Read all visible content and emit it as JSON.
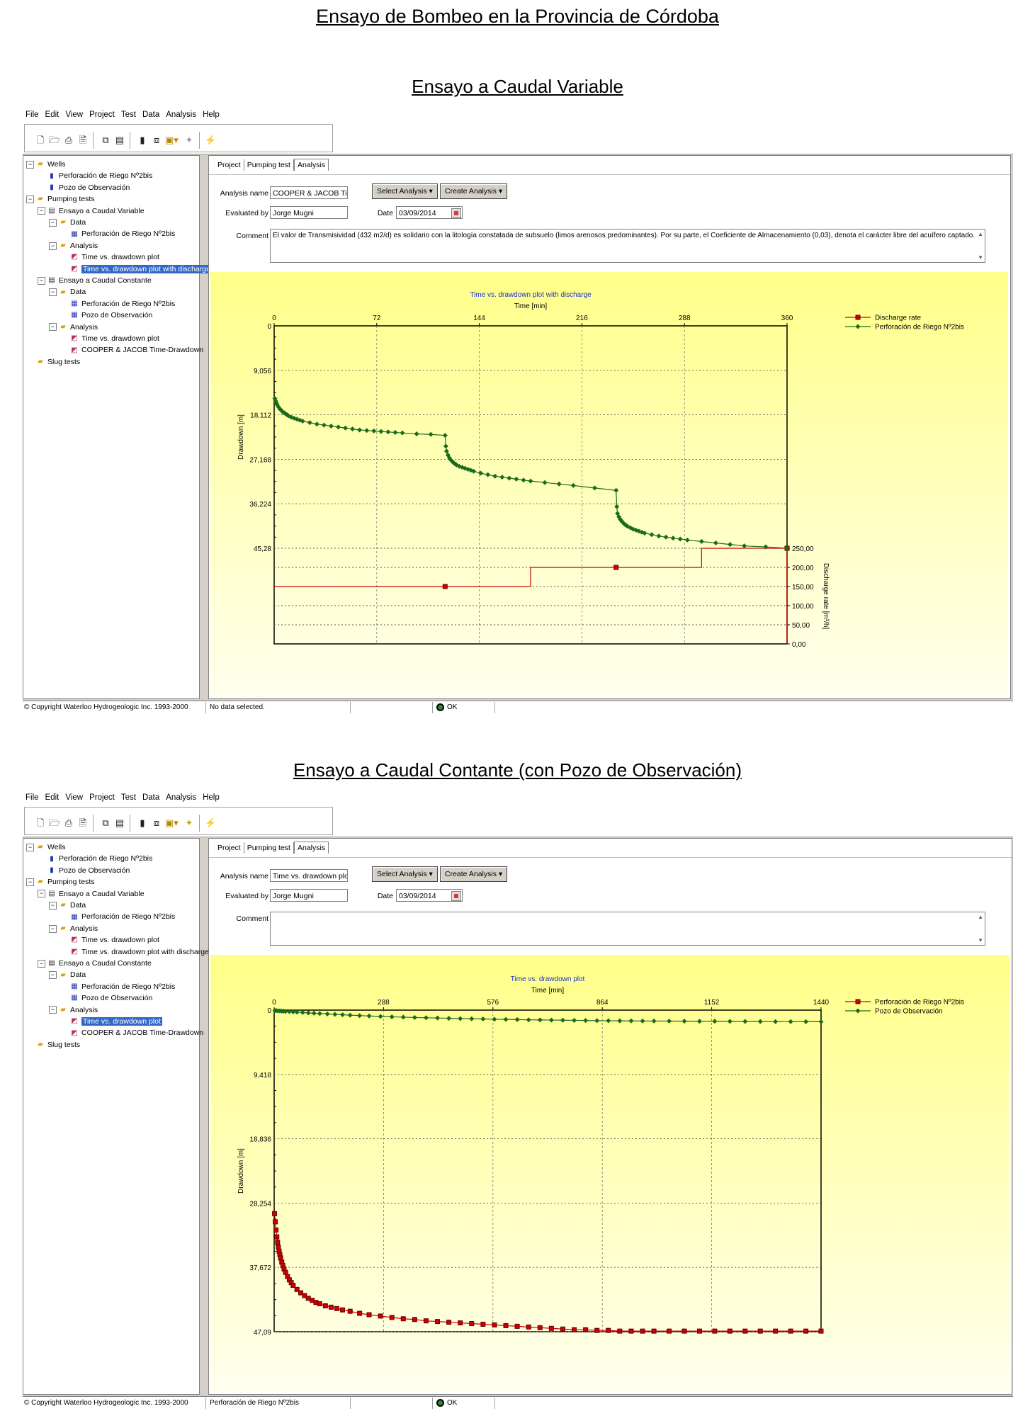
{
  "doc_title": "Ensayo de Bombeo en la Provincia de Córdoba",
  "menu": [
    "File",
    "Edit",
    "View",
    "Project",
    "Test",
    "Data",
    "Analysis",
    "Help"
  ],
  "toolbar_icons": [
    "new-file-icon",
    "open-folder-icon",
    "print-icon",
    "print-preview-icon",
    "copy-icon",
    "paste-icon",
    "clipboard-icon",
    "export-icon",
    "template-dropdown-icon",
    "lightbulb-icon",
    "wand-icon"
  ],
  "tabs": [
    "Project",
    "Pumping test",
    "Analysis"
  ],
  "form_labels": {
    "analysis_name": "Analysis name",
    "evaluated_by": "Evaluated by",
    "date": "Date",
    "comment": "Comment",
    "select_analysis": "Select Analysis",
    "create_analysis": "Create Analysis"
  },
  "panels": [
    {
      "section_title": "Ensayo a Caudal Variable",
      "tree": [
        {
          "label": "Wells",
          "level": 0,
          "icon": "folder",
          "expander": "-"
        },
        {
          "label": "Perforación de Riego Nº2bis",
          "level": 1,
          "icon": "well"
        },
        {
          "label": "Pozo de Observación",
          "level": 1,
          "icon": "well"
        },
        {
          "label": "Pumping tests",
          "level": 0,
          "icon": "folder",
          "expander": "-"
        },
        {
          "label": "Ensayo a Caudal Variable",
          "level": 1,
          "icon": "doc",
          "expander": "-"
        },
        {
          "label": "Data",
          "level": 2,
          "icon": "folder",
          "expander": "-"
        },
        {
          "label": "Perforación de Riego Nº2bis",
          "level": 3,
          "icon": "grid"
        },
        {
          "label": "Analysis",
          "level": 2,
          "icon": "folder",
          "expander": "-"
        },
        {
          "label": "Time vs. drawdown plot",
          "level": 3,
          "icon": "plot"
        },
        {
          "label": "Time vs. drawdown plot with discharge",
          "level": 3,
          "icon": "plot",
          "selected": true
        },
        {
          "label": "Ensayo a Caudal Constante",
          "level": 1,
          "icon": "doc",
          "expander": "-"
        },
        {
          "label": "Data",
          "level": 2,
          "icon": "folder",
          "expander": "-"
        },
        {
          "label": "Perforación de Riego Nº2bis",
          "level": 3,
          "icon": "grid"
        },
        {
          "label": "Pozo de Observación",
          "level": 3,
          "icon": "grid"
        },
        {
          "label": "Analysis",
          "level": 2,
          "icon": "folder",
          "expander": "-"
        },
        {
          "label": "Time vs. drawdown plot",
          "level": 3,
          "icon": "plot"
        },
        {
          "label": "COOPER & JACOB Time-Drawdown",
          "level": 3,
          "icon": "plot"
        },
        {
          "label": "Slug tests",
          "level": 0,
          "icon": "folder"
        }
      ],
      "analysis_name": "COOPER & JACOB Time-D",
      "evaluated_by": "Jorge Mugni",
      "date": "03/09/2014",
      "comment": "El valor de Transmisividad (432 m2/d) es solidario con la litología constatada de subsuelo (limos arenosos predominantes). Por su parte, el Coeficiente de Almacenamiento (0,03), denota el carácter libre del acuífero captado.",
      "status": {
        "copyright": "© Copyright Waterloo Hydrogeologic Inc. 1993-2000",
        "message": "No data selected.",
        "ok": "OK"
      }
    },
    {
      "section_title": "Ensayo a Caudal Contante (con Pozo de Observación)",
      "tree": [
        {
          "label": "Wells",
          "level": 0,
          "icon": "folder",
          "expander": "-"
        },
        {
          "label": "Perforación de Riego Nº2bis",
          "level": 1,
          "icon": "well"
        },
        {
          "label": "Pozo de Observación",
          "level": 1,
          "icon": "well"
        },
        {
          "label": "Pumping tests",
          "level": 0,
          "icon": "folder",
          "expander": "-"
        },
        {
          "label": "Ensayo a Caudal Variable",
          "level": 1,
          "icon": "doc",
          "expander": "-"
        },
        {
          "label": "Data",
          "level": 2,
          "icon": "folder",
          "expander": "-"
        },
        {
          "label": "Perforación de Riego Nº2bis",
          "level": 3,
          "icon": "grid"
        },
        {
          "label": "Analysis",
          "level": 2,
          "icon": "folder",
          "expander": "-"
        },
        {
          "label": "Time vs. drawdown plot",
          "level": 3,
          "icon": "plot"
        },
        {
          "label": "Time vs. drawdown plot with discharge",
          "level": 3,
          "icon": "plot"
        },
        {
          "label": "Ensayo a Caudal Constante",
          "level": 1,
          "icon": "doc",
          "expander": "-"
        },
        {
          "label": "Data",
          "level": 2,
          "icon": "folder",
          "expander": "-"
        },
        {
          "label": "Perforación de Riego Nº2bis",
          "level": 3,
          "icon": "grid"
        },
        {
          "label": "Pozo de Observación",
          "level": 3,
          "icon": "grid"
        },
        {
          "label": "Analysis",
          "level": 2,
          "icon": "folder",
          "expander": "-"
        },
        {
          "label": "Time vs. drawdown plot",
          "level": 3,
          "icon": "plot",
          "selected": true
        },
        {
          "label": "COOPER & JACOB Time-Drawdown",
          "level": 3,
          "icon": "plot"
        },
        {
          "label": "Slug tests",
          "level": 0,
          "icon": "folder"
        }
      ],
      "analysis_name": "Time vs. drawdown plot",
      "evaluated_by": "Jorge Mugni",
      "date": "03/09/2014",
      "comment": "",
      "status": {
        "copyright": "© Copyright Waterloo Hydrogeologic Inc. 1993-2000",
        "message": "Perforación de Riego Nº2bis",
        "ok": "OK"
      }
    }
  ],
  "chart_data": [
    {
      "type": "line",
      "title": "Time vs. drawdown plot with discharge",
      "xlabel": "Time [min]",
      "ylabel": "Drawdown [m]",
      "y2label": "Discharge rate [m³/h]",
      "xlim": [
        0,
        360
      ],
      "ylim": [
        0,
        45.28
      ],
      "y_inverted": true,
      "x_ticks": [
        "0",
        "72",
        "144",
        "216",
        "288",
        "360"
      ],
      "y_ticks": [
        "0",
        "9,056",
        "18,112",
        "27,168",
        "36,224",
        "45,28"
      ],
      "y2lim": [
        0,
        250
      ],
      "y2_ticks": [
        "250,00",
        "200,00",
        "150,00",
        "100,00",
        "50,00",
        "0,00"
      ],
      "legend_position": "right",
      "series": [
        {
          "name": "Discharge rate",
          "color": "#cc0000",
          "marker": "square",
          "axis": "y2",
          "step": true,
          "x": [
            0,
            180,
            180,
            300,
            300,
            360
          ],
          "y": [
            150,
            150,
            200,
            200,
            250,
            250
          ],
          "markers_x": [
            120,
            240,
            360
          ],
          "markers_y": [
            150,
            200,
            250
          ]
        },
        {
          "name": "Perforación de Riego Nº2bis",
          "color": "#1a6b1a",
          "marker": "diamond",
          "axis": "y",
          "x": [
            0.5,
            1,
            1.5,
            2,
            3,
            4,
            5,
            6,
            7,
            8,
            9,
            10,
            12,
            14,
            16,
            18,
            20,
            25,
            30,
            35,
            40,
            45,
            50,
            55,
            60,
            65,
            70,
            75,
            80,
            85,
            90,
            100,
            110,
            120,
            120.5,
            121,
            122,
            123,
            124,
            125,
            126,
            127,
            128,
            130,
            132,
            134,
            136,
            138,
            140,
            145,
            150,
            155,
            160,
            165,
            170,
            175,
            180,
            190,
            200,
            210,
            225,
            240,
            240.5,
            241,
            242,
            243,
            244,
            245,
            246,
            247,
            248,
            250,
            252,
            254,
            256,
            258,
            260,
            265,
            270,
            275,
            280,
            285,
            290,
            300,
            310,
            320,
            330,
            345,
            360
          ],
          "y": [
            14.8,
            15.3,
            15.7,
            16.0,
            16.5,
            16.9,
            17.2,
            17.5,
            17.7,
            17.9,
            18.1,
            18.3,
            18.6,
            18.8,
            19.0,
            19.2,
            19.4,
            19.7,
            20.0,
            20.2,
            20.4,
            20.6,
            20.8,
            21.0,
            21.2,
            21.3,
            21.4,
            21.5,
            21.6,
            21.7,
            21.8,
            22.0,
            22.1,
            22.3,
            24.5,
            25.5,
            26.3,
            26.9,
            27.3,
            27.6,
            27.9,
            28.1,
            28.3,
            28.6,
            28.8,
            29.0,
            29.2,
            29.4,
            29.6,
            30.0,
            30.3,
            30.6,
            30.8,
            31.0,
            31.2,
            31.4,
            31.6,
            31.9,
            32.2,
            32.5,
            33.0,
            33.5,
            36.8,
            38.2,
            38.9,
            39.4,
            39.8,
            40.1,
            40.4,
            40.6,
            40.8,
            41.1,
            41.4,
            41.6,
            41.8,
            42.0,
            42.2,
            42.5,
            42.8,
            43.0,
            43.2,
            43.4,
            43.6,
            43.9,
            44.2,
            44.5,
            44.8,
            45.0,
            45.28
          ]
        }
      ]
    },
    {
      "type": "line",
      "title": "Time vs. drawdown plot",
      "xlabel": "Time [min]",
      "ylabel": "Drawdown [m]",
      "xlim": [
        0,
        1440
      ],
      "ylim": [
        0,
        47.09
      ],
      "y_inverted": true,
      "x_ticks": [
        "0",
        "288",
        "576",
        "864",
        "1152",
        "1440"
      ],
      "y_ticks": [
        "0",
        "9,418",
        "18,836",
        "28,254",
        "37,672",
        "47,09"
      ],
      "legend_position": "right",
      "series": [
        {
          "name": "Perforación de Riego Nº2bis",
          "color": "#cc0000",
          "marker": "square",
          "x": [
            1,
            3,
            5,
            7,
            9,
            11,
            13,
            15,
            17,
            20,
            23,
            26,
            30,
            35,
            40,
            45,
            50,
            60,
            70,
            80,
            90,
            100,
            110,
            120,
            135,
            150,
            165,
            180,
            200,
            225,
            250,
            280,
            310,
            340,
            370,
            400,
            430,
            460,
            490,
            520,
            550,
            580,
            610,
            640,
            670,
            700,
            730,
            760,
            790,
            820,
            850,
            880,
            910,
            940,
            970,
            1000,
            1040,
            1080,
            1120,
            1160,
            1200,
            1240,
            1280,
            1320,
            1360,
            1400,
            1440
          ],
          "y": [
            29.8,
            31.0,
            32.2,
            33.2,
            34.0,
            34.7,
            35.3,
            35.8,
            36.3,
            36.9,
            37.4,
            37.9,
            38.4,
            39.0,
            39.5,
            39.9,
            40.3,
            40.9,
            41.4,
            41.8,
            42.2,
            42.5,
            42.8,
            43.0,
            43.3,
            43.5,
            43.7,
            43.9,
            44.1,
            44.4,
            44.6,
            44.8,
            45.0,
            45.2,
            45.3,
            45.5,
            45.6,
            45.7,
            45.8,
            45.9,
            46.0,
            46.1,
            46.2,
            46.3,
            46.4,
            46.5,
            46.6,
            46.7,
            46.8,
            46.8,
            46.9,
            46.9,
            47.0,
            47.0,
            47.0,
            47.0,
            47.0,
            47.0,
            47.0,
            47.0,
            47.0,
            47.0,
            47.0,
            47.0,
            47.0,
            47.0,
            47.0
          ]
        },
        {
          "name": "Pozo de Observación",
          "color": "#1a6b1a",
          "marker": "diamond",
          "x": [
            2,
            6,
            10,
            15,
            20,
            25,
            30,
            40,
            50,
            60,
            75,
            90,
            105,
            120,
            140,
            160,
            180,
            200,
            225,
            250,
            280,
            310,
            340,
            370,
            400,
            430,
            460,
            490,
            520,
            550,
            580,
            610,
            640,
            670,
            700,
            730,
            760,
            790,
            820,
            850,
            880,
            910,
            940,
            970,
            1000,
            1040,
            1080,
            1120,
            1160,
            1200,
            1240,
            1280,
            1320,
            1360,
            1400,
            1440
          ],
          "y": [
            0.05,
            0.08,
            0.1,
            0.12,
            0.14,
            0.16,
            0.18,
            0.22,
            0.26,
            0.3,
            0.35,
            0.4,
            0.45,
            0.5,
            0.56,
            0.62,
            0.68,
            0.74,
            0.8,
            0.86,
            0.92,
            0.98,
            1.03,
            1.08,
            1.12,
            1.16,
            1.2,
            1.24,
            1.27,
            1.3,
            1.33,
            1.36,
            1.39,
            1.42,
            1.44,
            1.46,
            1.48,
            1.5,
            1.52,
            1.54,
            1.56,
            1.57,
            1.58,
            1.59,
            1.6,
            1.61,
            1.62,
            1.63,
            1.64,
            1.65,
            1.66,
            1.67,
            1.68,
            1.69,
            1.7,
            1.7
          ]
        }
      ]
    }
  ]
}
